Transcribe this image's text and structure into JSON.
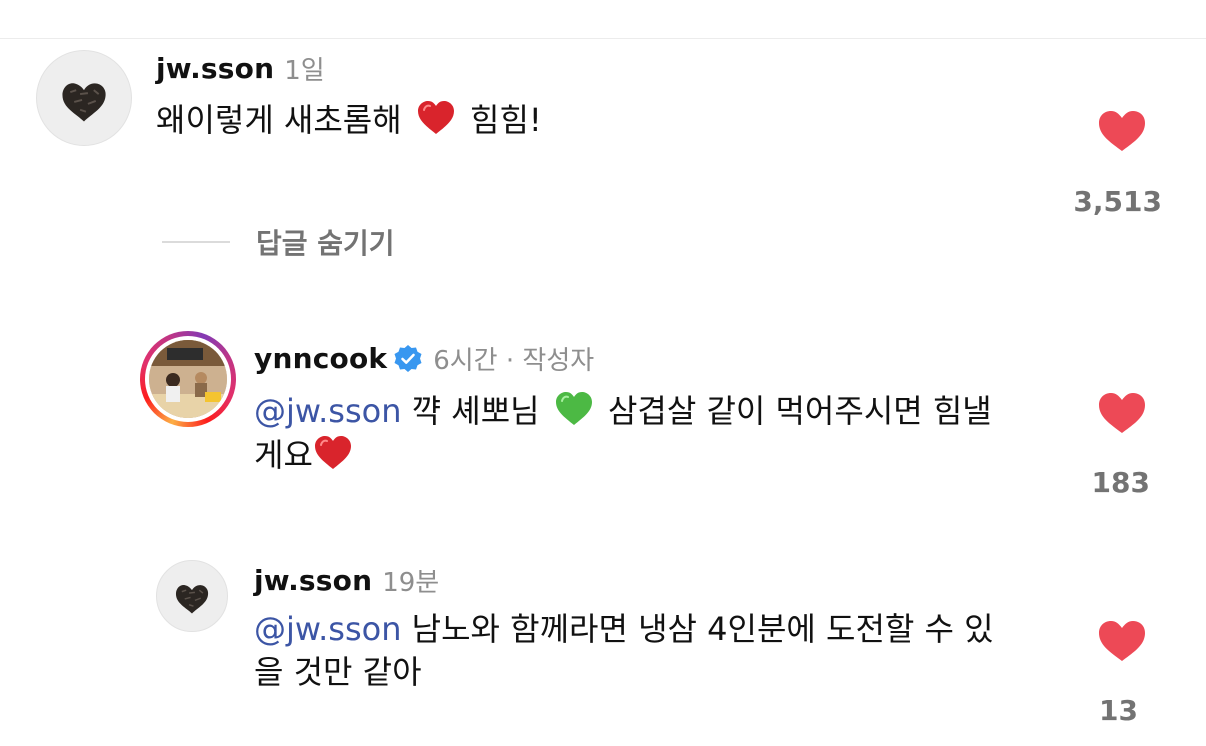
{
  "comments": [
    {
      "username": "jw.sson",
      "time": "1일",
      "text_before": "왜이렇게 새초롬해",
      "emoji": "red-heart-emoji",
      "text_after": "힘힘!",
      "like_count": "3,513"
    },
    {
      "username": "ynncook",
      "verified": true,
      "time": "6시간 · 작성자",
      "mention": "@jw.sson",
      "text_part1": "꺅 셰뽀님",
      "emoji1": "green-heart-emoji",
      "text_part2": "삼겹살 같이 먹어주시면 힘낼",
      "text_part3": "게요",
      "emoji2": "red-heart-emoji",
      "like_count": "183"
    },
    {
      "username": "jw.sson",
      "time": "19분",
      "mention": "@jw.sson",
      "text_line1": "남노와 함께라면 냉삼 4인분에 도전할 수 있",
      "text_line2": "을 것만 같아",
      "like_count": "13"
    }
  ],
  "replies_toggle": "답글 숨기기",
  "colors": {
    "like": "#ed4956",
    "mention": "#3c55a5",
    "muted": "#737373",
    "verified": "#3897f0"
  }
}
